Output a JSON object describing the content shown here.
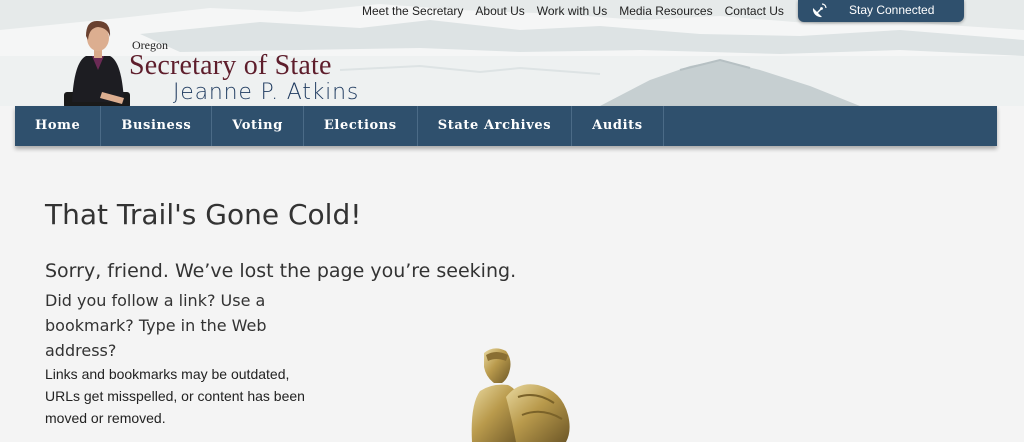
{
  "utility_nav": {
    "links": [
      "Meet the Secretary",
      "About Us",
      "Work with Us",
      "Media Resources",
      "Contact Us"
    ],
    "stay_connected": "Stay Connected"
  },
  "logo": {
    "state": "Oregon",
    "office": "Secretary of State",
    "name": "Jeanne P. Atkins"
  },
  "main_nav": {
    "items": [
      "Home",
      "Business",
      "Voting",
      "Elections",
      "State Archives",
      "Audits"
    ]
  },
  "content": {
    "title": "That Trail's Gone Cold!",
    "subtitle": "Sorry, friend. We’ve lost the page you’re seeking.",
    "question": "Did you follow a link? Use a bookmark? Type in the Web address?",
    "explanation": "Links and bookmarks may be outdated, URLs get misspelled, or content has been moved or removed."
  },
  "colors": {
    "nav_bg": "#2f506d",
    "logo_title": "#5e1e2c",
    "logo_name": "#1e3a5f",
    "page_bg": "#f4f4f4"
  },
  "icons": {
    "stay_connected": "satellite-dish-icon"
  }
}
